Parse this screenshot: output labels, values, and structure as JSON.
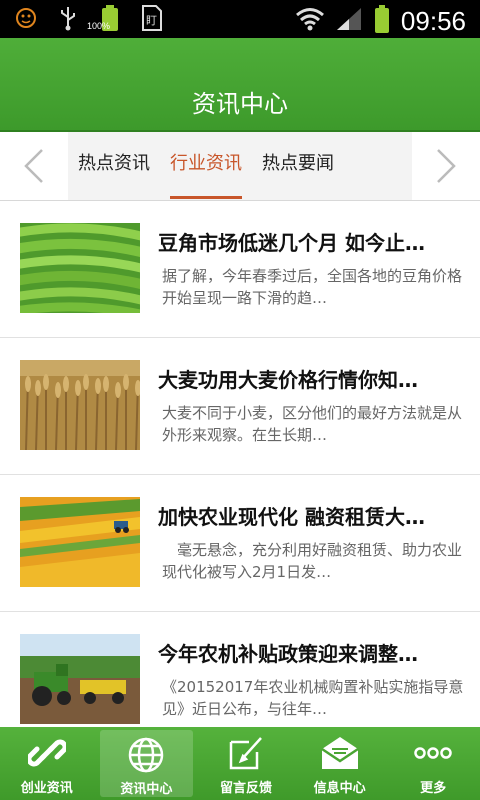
{
  "status_bar": {
    "time": "09:56",
    "battery_label": "100%",
    "icons": [
      "notification-face-icon",
      "usb-icon",
      "battery-icon",
      "sim-app-icon",
      "wifi-icon",
      "signal-icon",
      "battery-full-icon"
    ]
  },
  "header": {
    "title": "资讯中心"
  },
  "tabs": {
    "items": [
      {
        "label": "热点资讯"
      },
      {
        "label": "行业资讯",
        "active": true
      },
      {
        "label": "热点要闻"
      }
    ]
  },
  "articles": [
    {
      "title": "豆角市场低迷几个月 如今止…",
      "summary": "据了解，今年春季过后，全国各地的豆角价格开始呈现一路下滑的趋…",
      "image": "green-beans-image"
    },
    {
      "title": "大麦功用大麦价格行情你知…",
      "summary": "大麦不同于小麦，区分他们的最好方法就是从外形来观察。在生长期…",
      "image": "barley-field-image"
    },
    {
      "title": "加快农业现代化 融资租赁大…",
      "summary": "　毫无悬念，充分利用好融资租赁、助力农业现代化被写入2月1日发…",
      "image": "farm-fields-image"
    },
    {
      "title": "今年农机补贴政策迎来调整…",
      "summary": "《20152017年农业机械购置补贴实施指导意见》近日公布，与往年…",
      "image": "tractor-image"
    }
  ],
  "bottom_nav": {
    "items": [
      {
        "label": "创业资讯",
        "icon": "link-icon"
      },
      {
        "label": "资讯中心",
        "icon": "globe-icon",
        "active": true
      },
      {
        "label": "留言反馈",
        "icon": "edit-icon"
      },
      {
        "label": "信息中心",
        "icon": "mail-icon"
      },
      {
        "label": "更多",
        "icon": "more-icon"
      }
    ]
  },
  "colors": {
    "primary_green": "#4fae39",
    "active_tab": "#c8562a"
  }
}
